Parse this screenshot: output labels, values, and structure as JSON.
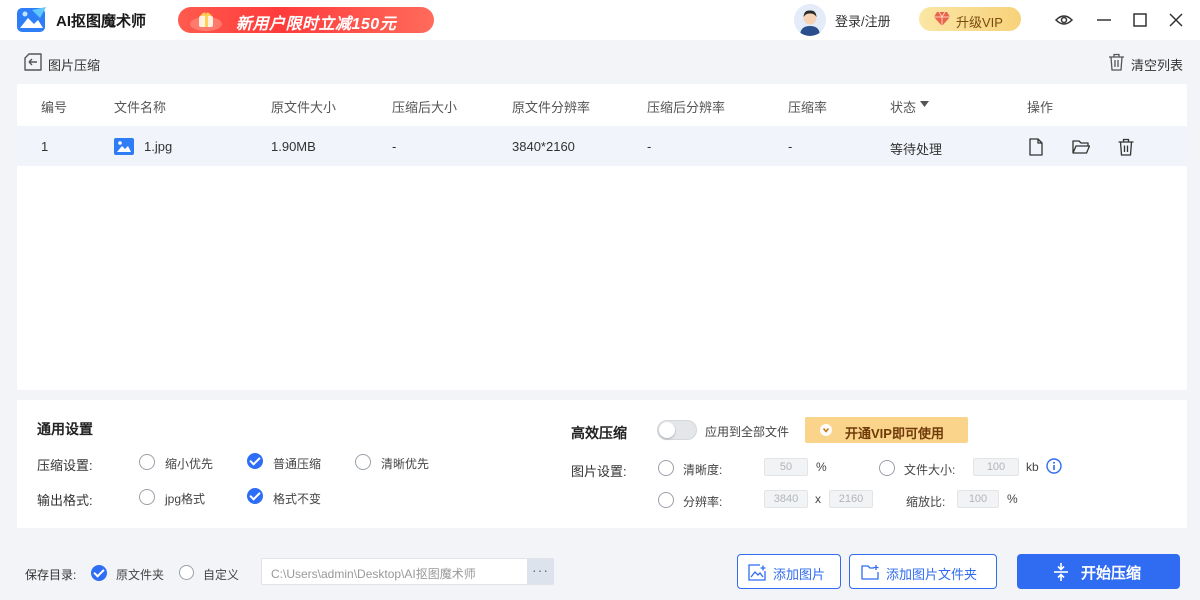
{
  "app": {
    "title": "AI抠图魔术师",
    "promo": "新用户限时立减150元",
    "login": "登录/注册",
    "vip": "升级VIP"
  },
  "page": {
    "title": "图片压缩",
    "clear": "清空列表"
  },
  "table": {
    "columns": [
      "编号",
      "文件名称",
      "原文件大小",
      "压缩后大小",
      "原文件分辨率",
      "压缩后分辨率",
      "压缩率",
      "状态",
      "操作"
    ],
    "rows": [
      {
        "index": "1",
        "name": "1.jpg",
        "orig_size": "1.90MB",
        "comp_size": "-",
        "orig_res": "3840*2160",
        "comp_res": "-",
        "ratio": "-",
        "status": "等待处理"
      }
    ]
  },
  "settings": {
    "general_title": "通用设置",
    "compress_label": "压缩设置:",
    "compress_options": [
      "缩小优先",
      "普通压缩",
      "清晰优先"
    ],
    "compress_selected": "普通压缩",
    "format_label": "输出格式:",
    "format_options": [
      "jpg格式",
      "格式不变"
    ],
    "format_selected": "格式不变",
    "efficient_title": "高效压缩",
    "apply_all": "应用到全部文件",
    "vip_open": "开通VIP即可使用",
    "image_label": "图片设置:",
    "clarity_label": "清晰度:",
    "clarity_value": "50",
    "clarity_unit": "%",
    "filesize_label": "文件大小:",
    "filesize_value": "100",
    "filesize_unit": "kb",
    "resolution_label": "分辨率:",
    "res_width": "3840",
    "res_x": "x",
    "res_height": "2160",
    "scale_label": "缩放比:",
    "scale_value": "100",
    "scale_unit": "%"
  },
  "bottom": {
    "save_dir_label": "保存目录:",
    "original_folder": "原文件夹",
    "custom": "自定义",
    "save_selected": "原文件夹",
    "path_placeholder": "C:\\Users\\admin\\Desktop\\AI抠图魔术师",
    "dots": "···",
    "add_images": "添加图片",
    "add_folder": "添加图片文件夹",
    "start": "开始压缩"
  },
  "colors": {
    "accent": "#2f6cf2",
    "promo": "#ff4a42",
    "vip_gold": "#f7d27a"
  }
}
